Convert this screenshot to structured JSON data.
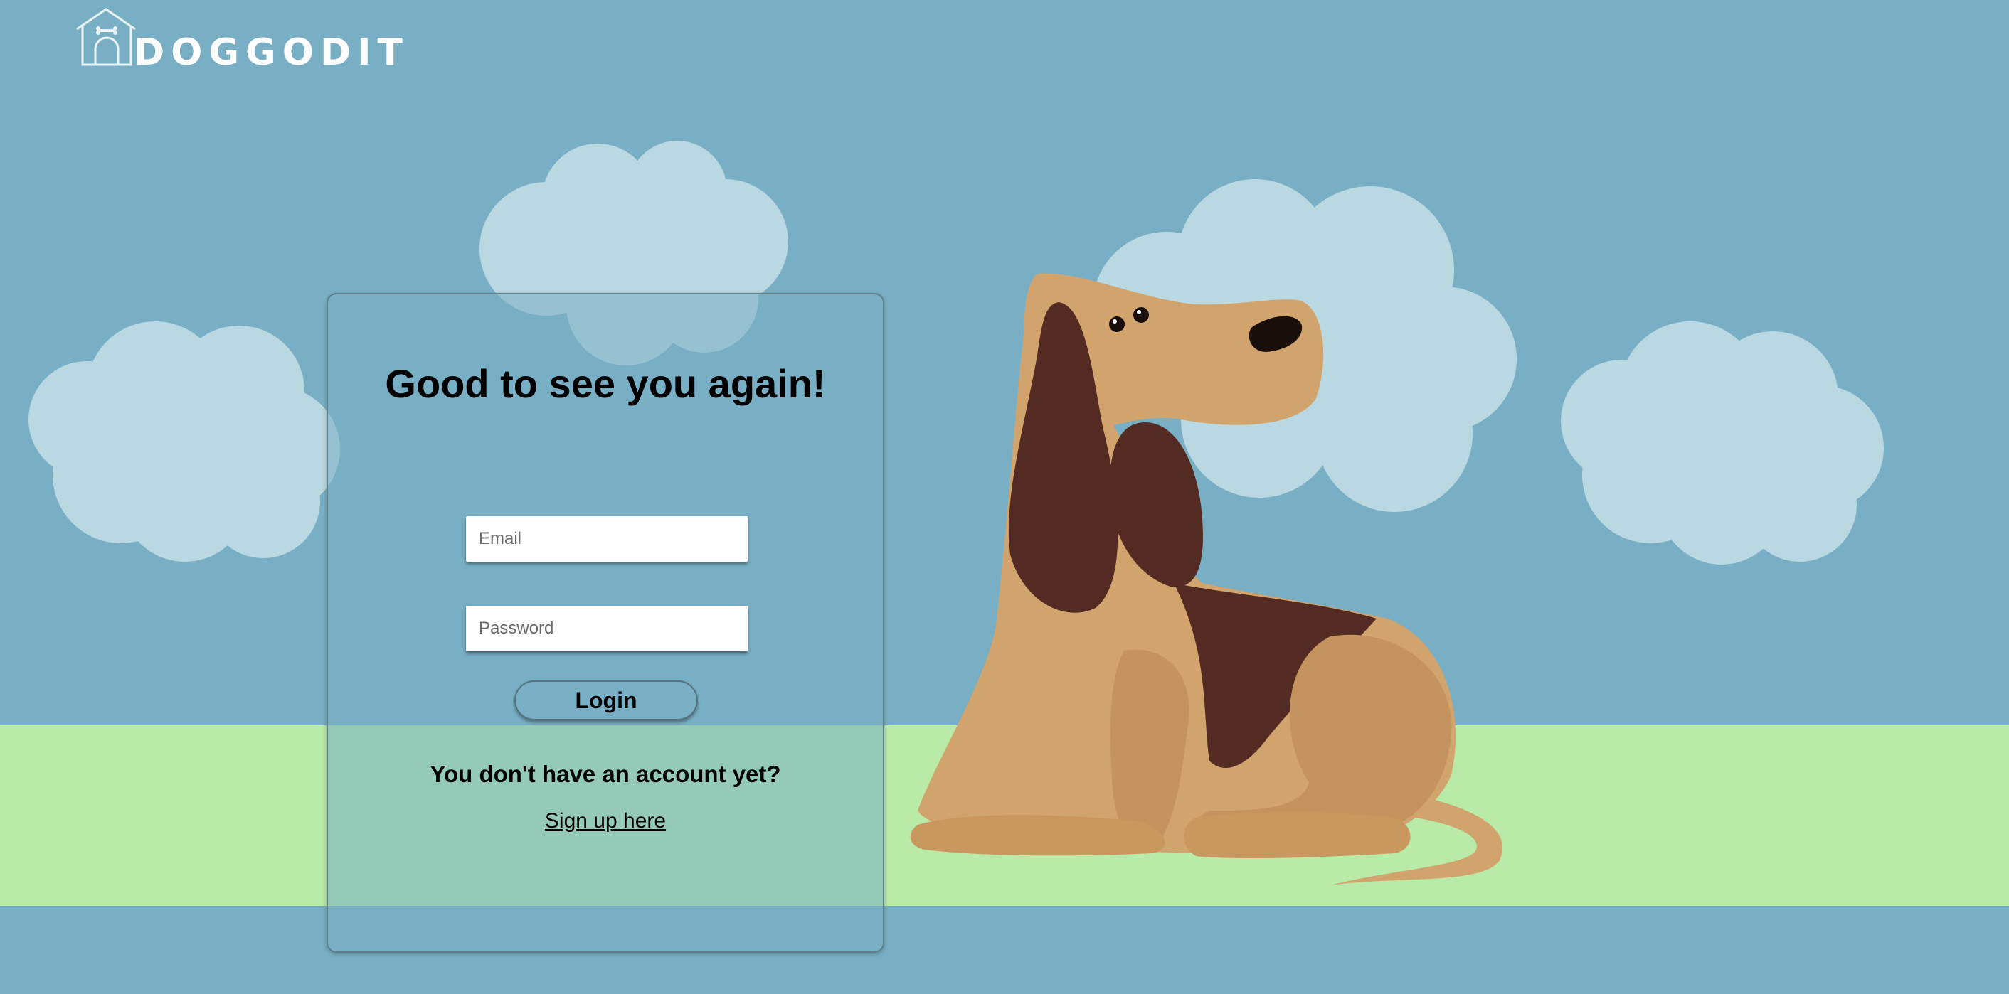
{
  "brand": {
    "name": "DOGGODIT",
    "logo_icon": "doghouse-icon"
  },
  "login": {
    "title": "Good to see you again!",
    "email_placeholder": "Email",
    "password_placeholder": "Password",
    "login_label": "Login",
    "signup_prompt": "You don't have an account yet?",
    "signup_link": "Sign up here"
  },
  "colors": {
    "sky": "#79afc4",
    "grass": "#b9eaa8",
    "cloud": "#bad8e1",
    "dog_body": "#d2a46d",
    "dog_ears": "#532b22"
  }
}
